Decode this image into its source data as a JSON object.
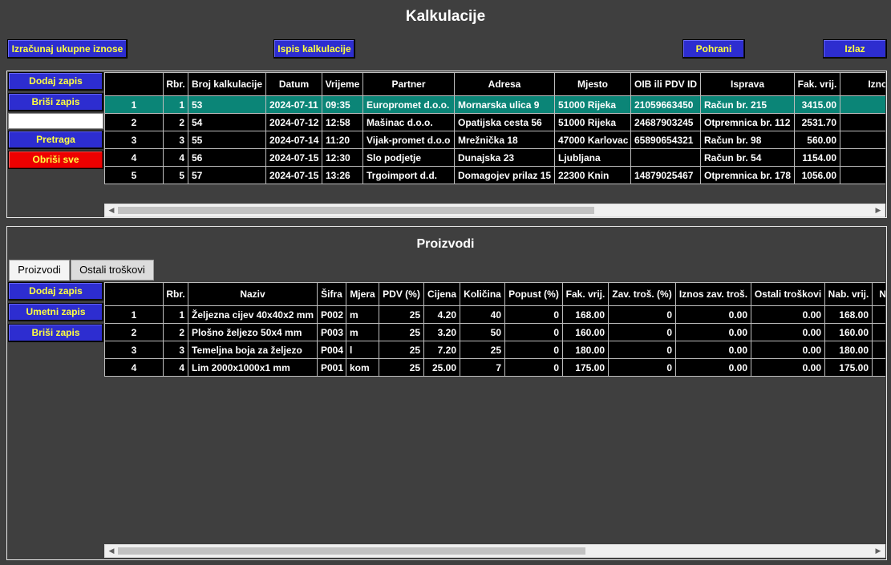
{
  "app": {
    "title": "Kalkulacije"
  },
  "toolbar": {
    "calc_totals": "Izračunaj ukupne iznose",
    "print": "Ispis kalkulacije",
    "save": "Pohrani",
    "exit": "Izlaz"
  },
  "top_side": {
    "add": "Dodaj zapis",
    "delete": "Briši zapis",
    "search_value": "",
    "search": "Pretraga",
    "clear_all": "Obriši sve"
  },
  "calc_table": {
    "headers": [
      "",
      "Rbr.",
      "Broj kalkulacije",
      "Datum",
      "Vrijeme",
      "Partner",
      "Adresa",
      "Mjesto",
      "OIB ili PDV ID",
      "Isprava",
      "Fak. vrij.",
      "Iznos zav"
    ],
    "rows": [
      [
        "1",
        "1",
        "53",
        "2024-07-11",
        "09:35",
        "Europromet d.o.o.",
        "Mornarska ulica 9",
        "51000 Rijeka",
        "21059663450",
        "Račun br. 215",
        "3415.00",
        ""
      ],
      [
        "2",
        "2",
        "54",
        "2024-07-12",
        "12:58",
        "Mašinac d.o.o.",
        "Opatijska cesta 56",
        "51000 Rijeka",
        "24687903245",
        "Otpremnica br. 112",
        "2531.70",
        ""
      ],
      [
        "3",
        "3",
        "55",
        "2024-07-14",
        "11:20",
        "Vijak-promet d.o.o",
        "Mrežnička 18",
        "47000 Karlovac",
        "65890654321",
        "Račun br. 98",
        "560.00",
        ""
      ],
      [
        "4",
        "4",
        "56",
        "2024-07-15",
        "12:30",
        "Slo podjetje",
        "Dunajska 23",
        "Ljubljana",
        "",
        "Račun br. 54",
        "1154.00",
        ""
      ],
      [
        "5",
        "5",
        "57",
        "2024-07-15",
        "13:26",
        "Trgoimport d.d.",
        "Domagojev prilaz 15",
        "22300 Knin",
        "14879025467",
        "Otpremnica br. 178",
        "1056.00",
        ""
      ]
    ],
    "selected_row": 0
  },
  "products": {
    "title": "Proizvodi",
    "tabs": [
      "Proizvodi",
      "Ostali troškovi"
    ],
    "active_tab": 0,
    "side": {
      "add": "Dodaj zapis",
      "insert": "Umetni zapis",
      "delete": "Briši zapis"
    },
    "headers": [
      "",
      "Rbr.",
      "Naziv",
      "Šifra",
      "Mjera",
      "PDV (%)",
      "Cijena",
      "Količina",
      "Popust (%)",
      "Fak. vrij.",
      "Zav. troš. (%)",
      "Iznos zav. troš.",
      "Ostali troškovi",
      "Nab. vrij.",
      "Na"
    ],
    "rows": [
      [
        "1",
        "1",
        "Željezna cijev 40x40x2 mm",
        "P002",
        "m",
        "25",
        "4.20",
        "40",
        "0",
        "168.00",
        "0",
        "0.00",
        "0.00",
        "168.00",
        ""
      ],
      [
        "2",
        "2",
        "Plošno željezo 50x4 mm",
        "P003",
        "m",
        "25",
        "3.20",
        "50",
        "0",
        "160.00",
        "0",
        "0.00",
        "0.00",
        "160.00",
        ""
      ],
      [
        "3",
        "3",
        "Temeljna boja za željezo",
        "P004",
        "l",
        "25",
        "7.20",
        "25",
        "0",
        "180.00",
        "0",
        "0.00",
        "0.00",
        "180.00",
        ""
      ],
      [
        "4",
        "4",
        "Lim 2000x1000x1 mm",
        "P001",
        "kom",
        "25",
        "25.00",
        "7",
        "0",
        "175.00",
        "0",
        "0.00",
        "0.00",
        "175.00",
        ""
      ]
    ]
  },
  "icons": {
    "scroll_left": "◀",
    "scroll_right": "▶"
  }
}
